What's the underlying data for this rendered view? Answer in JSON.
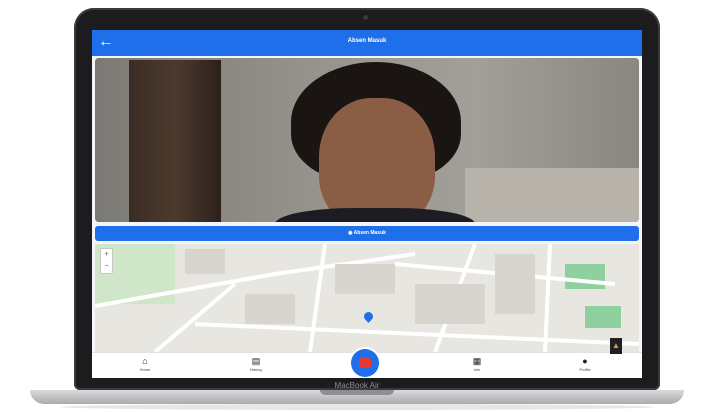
{
  "app": {
    "title": "Absen Masuk",
    "back_icon": "arrow-left-icon",
    "accent_color": "#1f6feb"
  },
  "camera": {
    "checkin_button_label": "Absen Masuk",
    "checkin_icon": "camera-icon"
  },
  "map": {
    "zoom_in_label": "+",
    "zoom_out_label": "−"
  },
  "bottom_nav": {
    "items": [
      {
        "label": "Home",
        "icon": "home-icon"
      },
      {
        "label": "History",
        "icon": "document-icon"
      },
      {
        "label": "Izin",
        "icon": "calendar-icon"
      },
      {
        "label": "Profile",
        "icon": "user-icon"
      }
    ],
    "fab_icon": "camera-fab-icon"
  },
  "device": {
    "brand_label": "MacBook Air"
  }
}
